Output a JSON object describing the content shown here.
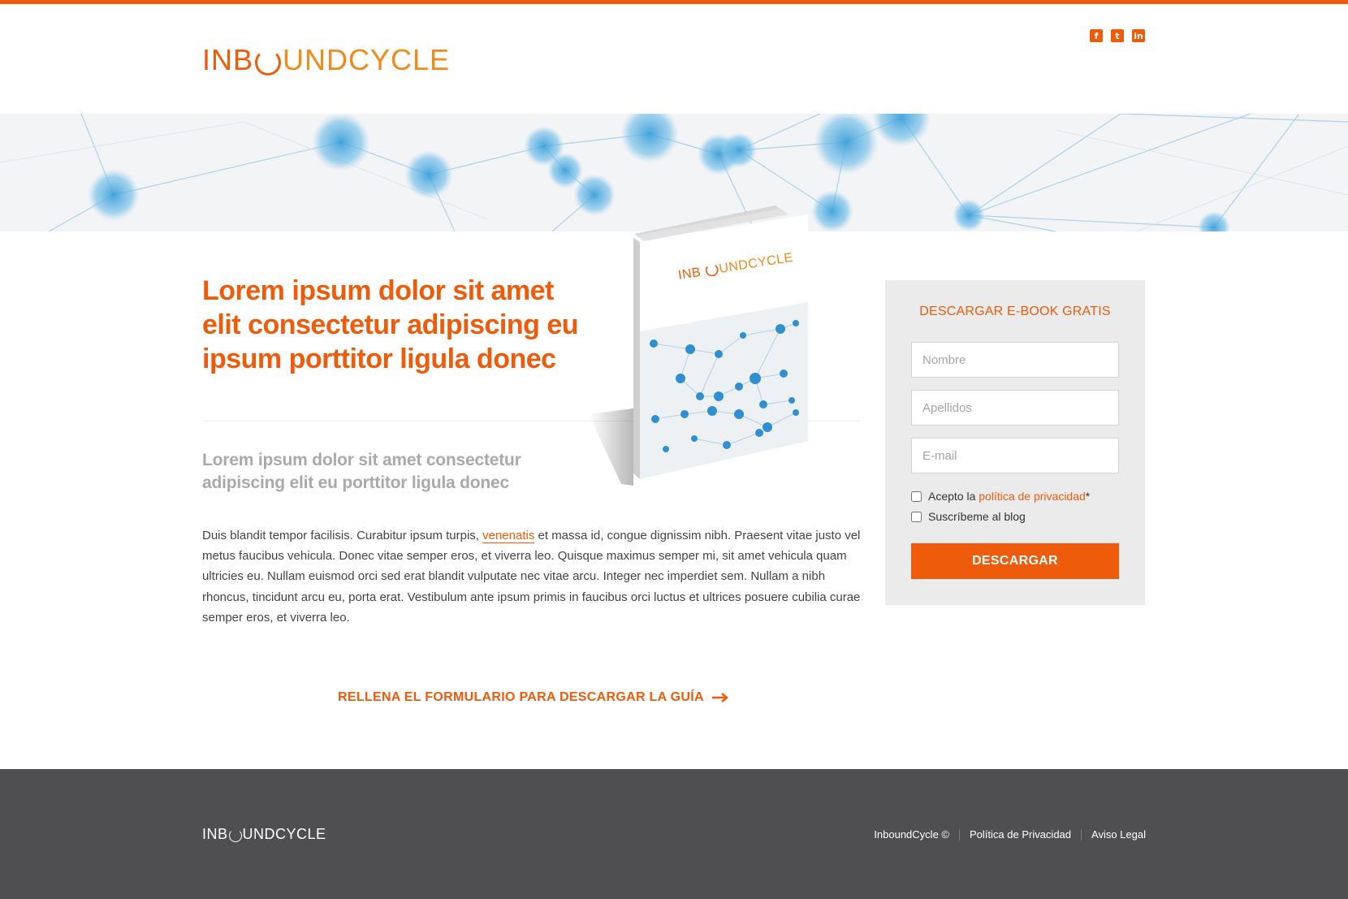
{
  "header": {
    "logo_left": "INB",
    "logo_mid": "UND",
    "logo_right": "CYCLE",
    "social": [
      {
        "icon": "facebook-icon",
        "glyph": "f"
      },
      {
        "icon": "twitter-icon",
        "glyph": "t"
      },
      {
        "icon": "linkedin-icon",
        "glyph": "in"
      }
    ]
  },
  "main": {
    "headline": "Lorem ipsum dolor sit amet elit consectetur adipiscing eu ipsum  porttitor ligula donec",
    "subhead": "Lorem ipsum dolor sit amet consectetur adipiscing elit eu porttitor ligula donec",
    "body_before": "Duis blandit tempor facilisis. Curabitur ipsum turpis, ",
    "body_link": "venenatis",
    "body_after": " et massa id, congue dignissim nibh. Praesent vitae justo vel metus faucibus vehicula. Donec vitae semper eros, et viverra leo. Quisque maximus semper mi, sit amet vehicula quam ultricies eu. Nullam euismod orci sed erat blandit vulputate nec vitae arcu. Integer nec imperdiet sem. Nullam a nibh rhoncus, tincidunt arcu eu, porta erat. Vestibulum ante ipsum primis in faucibus orci luctus et ultrices posuere cubilia curae semper eros, et viverra leo.",
    "cta": "RELLENA EL FORMULARIO PARA DESCARGAR LA GUÍA",
    "book_logo_left": "INB",
    "book_logo_right": "UNDCYCLE"
  },
  "form": {
    "title": "DESCARGAR E-BOOK GRATIS",
    "name_placeholder": "Nombre",
    "lastname_placeholder": "Apellidos",
    "email_placeholder": "E-mail",
    "privacy_prefix": "Acepto la ",
    "privacy_link": "política de privacidad",
    "privacy_suffix": "*",
    "subscribe_label": "Suscríbeme al blog",
    "submit_label": "DESCARGAR"
  },
  "footer": {
    "logo_left": "INB",
    "logo_right": "UNDCYCLE",
    "links": [
      "InboundCycle ©",
      "Política de Privacidad",
      "Aviso Legal"
    ]
  },
  "colors": {
    "accent": "#ee5b0a",
    "footer_bg": "#4f4f51",
    "form_bg": "#ebebeb"
  }
}
